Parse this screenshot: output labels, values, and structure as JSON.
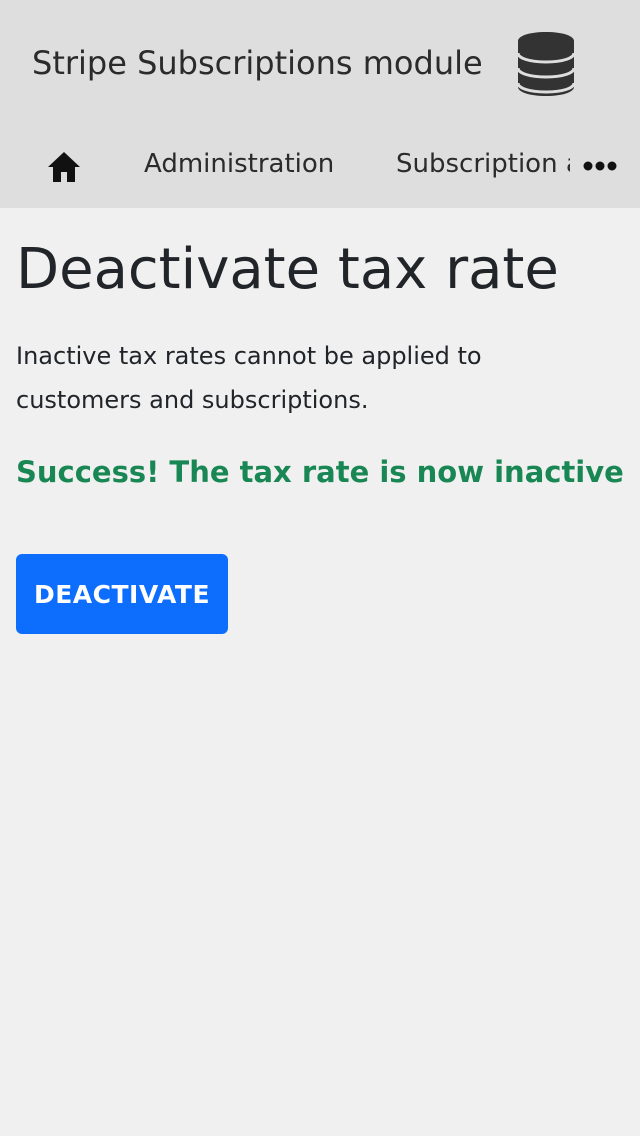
{
  "header": {
    "title": "Stripe Subscriptions module",
    "icon": "database-icon"
  },
  "nav": {
    "home_icon": "home-icon",
    "items": [
      {
        "label": "Administration"
      },
      {
        "label": "Subscription admin"
      }
    ],
    "more_icon": "more-horizontal-icon"
  },
  "main": {
    "title": "Deactivate tax rate",
    "description": "Inactive tax rates cannot be applied to customers and subscriptions.",
    "success_message": "Success! The tax rate is now inactive",
    "deactivate_button": "DEACTIVATE"
  },
  "colors": {
    "header_bg": "#dedede",
    "page_bg": "#f0f0f0",
    "success": "#198754",
    "primary": "#0d6efd"
  }
}
